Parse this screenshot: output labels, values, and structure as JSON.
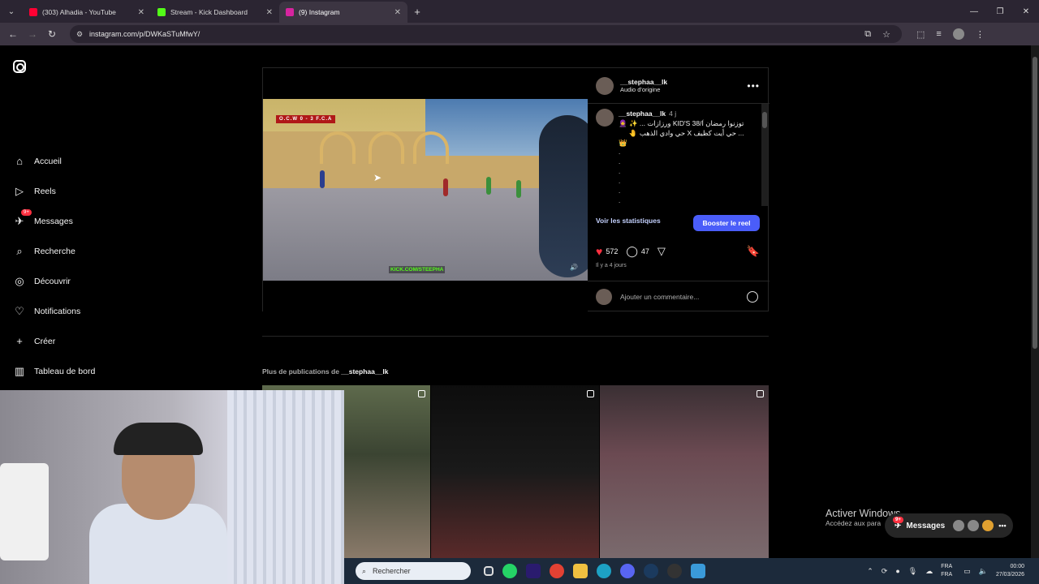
{
  "browser": {
    "tabs": [
      {
        "title": "(303) Alhadia - YouTube",
        "color": "#ff0033",
        "active": false
      },
      {
        "title": "Stream - Kick Dashboard",
        "color": "#53fc18",
        "active": false
      },
      {
        "title": "(9) Instagram",
        "color": "#d6249f",
        "active": true
      }
    ],
    "url": "instagram.com/p/DWKaSTuMfwY/"
  },
  "sidebar": {
    "items": [
      {
        "label": "Accueil",
        "icon": "home-icon"
      },
      {
        "label": "Reels",
        "icon": "reels-icon"
      },
      {
        "label": "Messages",
        "icon": "messages-icon",
        "badge": "9+"
      },
      {
        "label": "Recherche",
        "icon": "search-icon"
      },
      {
        "label": "Découvrir",
        "icon": "compass-icon"
      },
      {
        "label": "Notifications",
        "icon": "heart-icon"
      },
      {
        "label": "Créer",
        "icon": "plus-icon"
      },
      {
        "label": "Tableau de bord",
        "icon": "dashboard-icon"
      }
    ]
  },
  "post": {
    "username": "__stephaa__lk",
    "audio": "Audio d'origine",
    "caption_time": "4 j",
    "caption_line1": "توزنوا رمضان KID'S 38/Í ورزازات ... ✨ 🧕",
    "caption_line2": "... حي أيت كظيف  X  حي وادي الذهب 🤚",
    "caption_line3": "👑",
    "video_overlay": "KICK.COM/STEEPHA",
    "score": "O.C.W 0 - 3 F.C.A",
    "stats_link": "Voir les statistiques",
    "boost_label": "Booster le reel",
    "likes": "572",
    "comments": "47",
    "ago": "Il y a 4 jours",
    "comment_placeholder": "Ajouter un commentaire..."
  },
  "more": {
    "prefix": "Plus de publications de ",
    "user": "__stephaa__lk"
  },
  "overlay": {
    "watermark_title": "Activer Windows",
    "watermark_sub": "Accédez aux para",
    "messages_label": "Messages",
    "messages_badge": "9+"
  },
  "taskbar": {
    "search_placeholder": "Rechercher",
    "lang1": "FRA",
    "lang2": "FRA",
    "time": "00:00",
    "date": "27/03/2026"
  }
}
